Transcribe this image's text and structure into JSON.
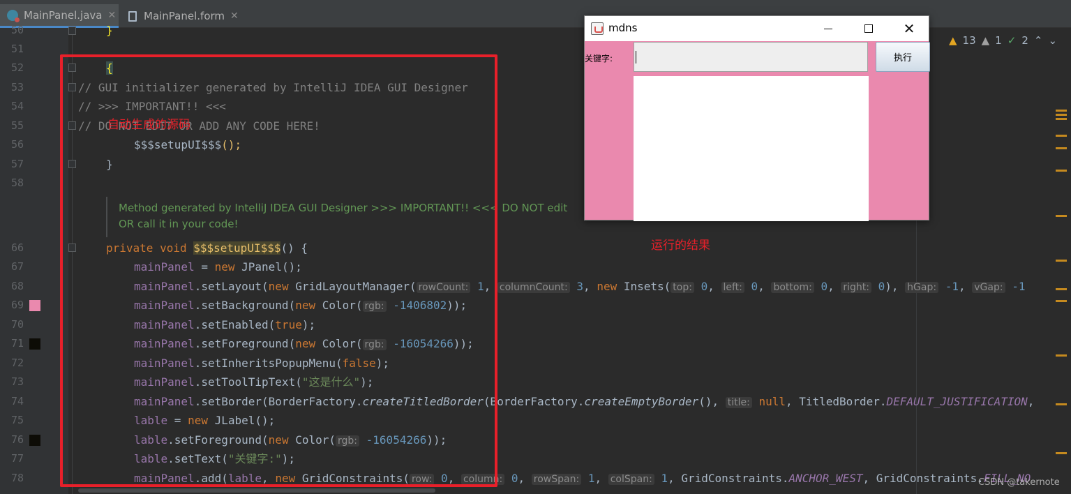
{
  "tabs": [
    {
      "label": "MainPanel.java",
      "active": true
    },
    {
      "label": "MainPanel.form",
      "active": false
    }
  ],
  "inspections": {
    "warnings": "13",
    "weak_warnings": "1",
    "typos": "2"
  },
  "lines": {
    "l50": {
      "num": "50",
      "code": "}"
    },
    "l51": {
      "num": "51"
    },
    "l52": {
      "num": "52",
      "code": "{"
    },
    "l53": {
      "num": "53",
      "code": "// GUI initializer generated by IntelliJ IDEA GUI Designer"
    },
    "l54": {
      "num": "54",
      "code": "// >>> IMPORTANT!! <<<"
    },
    "l55": {
      "num": "55",
      "code": "// DO NOT EDIT OR ADD ANY CODE HERE!"
    },
    "l56": {
      "num": "56",
      "method": "$$$setupUI$$$",
      "paren": "();"
    },
    "l57": {
      "num": "57",
      "code": "}"
    },
    "l58": {
      "num": "58"
    },
    "doc1": "Method generated by IntelliJ IDEA GUI Designer >>> IMPORTANT!! <<< DO NOT edit",
    "doc2": "OR call it in your code!",
    "l66": {
      "num": "66",
      "kw1": "private",
      "kw2": "void",
      "name": "$$$setupUI$$$",
      "rest": "() {"
    },
    "l67": {
      "num": "67",
      "fld": "mainPanel",
      "a": " = ",
      "kw": "new",
      "b": " JPanel();"
    },
    "l68": {
      "num": "68",
      "fld": "mainPanel",
      "a": ".setLayout(",
      "kw": "new",
      "b": " GridLayoutManager(",
      "h1": "rowCount:",
      "v1": "1",
      "c1": ", ",
      "h2": "columnCount:",
      "v2": "3",
      "c2": ", ",
      "kw2": "new",
      "d": " Insets(",
      "h3": "top:",
      "v3": "0",
      "h4": "left:",
      "v4": "0",
      "h5": "bottom:",
      "v5": "0",
      "h6": "right:",
      "v6": "0",
      "e": "), ",
      "h7": "hGap:",
      "v7": "-1",
      "h8": "vGap:",
      "v8": "-1"
    },
    "l69": {
      "num": "69",
      "fld": "mainPanel",
      "a": ".setBackground(",
      "kw": "new",
      "b": " Color(",
      "h1": "rgb:",
      "v1": "-1406802",
      "c": "));"
    },
    "l70": {
      "num": "70",
      "fld": "mainPanel",
      "a": ".setEnabled(",
      "kw": "true",
      "c": ");"
    },
    "l71": {
      "num": "71",
      "fld": "mainPanel",
      "a": ".setForeground(",
      "kw": "new",
      "b": " Color(",
      "h1": "rgb:",
      "v1": "-16054266",
      "c": "));"
    },
    "l72": {
      "num": "72",
      "fld": "mainPanel",
      "a": ".setInheritsPopupMenu(",
      "kw": "false",
      "c": ");"
    },
    "l73": {
      "num": "73",
      "fld": "mainPanel",
      "a": ".setToolTipText(",
      "s": "\"这是什么\"",
      "c": ");"
    },
    "l74": {
      "num": "74",
      "fld": "mainPanel",
      "a": ".setBorder(BorderFactory.",
      "m1": "createTitledBorder",
      "b": "(BorderFactory.",
      "m2": "createEmptyBorder",
      "c": "(), ",
      "h1": "title:",
      "kw": "null",
      "d": ", TitledBorder.",
      "f": "DEFAULT_JUSTIFICATION",
      "e": ","
    },
    "l75": {
      "num": "75",
      "fld": "lable",
      "a": " = ",
      "kw": "new",
      "b": " JLabel();"
    },
    "l76": {
      "num": "76",
      "fld": "lable",
      "a": ".setForeground(",
      "kw": "new",
      "b": " Color(",
      "h1": "rgb:",
      "v1": "-16054266",
      "c": "));"
    },
    "l77": {
      "num": "77",
      "fld": "lable",
      "a": ".setText(",
      "s": "\"关键字:\"",
      "c": ");"
    },
    "l78": {
      "num": "78",
      "fld": "mainPanel",
      "a": ".add(",
      "fld2": "lable",
      "b": ", ",
      "kw": "new",
      "d": " GridConstraints(",
      "h1": "row:",
      "v1": "0",
      "h2": "column:",
      "v2": "0",
      "h3": "rowSpan:",
      "v3": "1",
      "h4": "colSpan:",
      "v4": "1",
      "e": ", GridConstraints.",
      "f1": "ANCHOR_WEST",
      "g": ", GridConstraints.",
      "f2": "FILL_NO"
    }
  },
  "annotations": {
    "generated": "自动生成的源码",
    "result": "运行的结果"
  },
  "swing": {
    "title": "mdns",
    "label": "关键字:",
    "button": "执行",
    "field_value": ""
  },
  "swatch_colors": {
    "l69": "#ea89ae",
    "l71": "#0d0c06",
    "l76": "#0d0c06"
  },
  "watermark": "CSDN @takernote"
}
